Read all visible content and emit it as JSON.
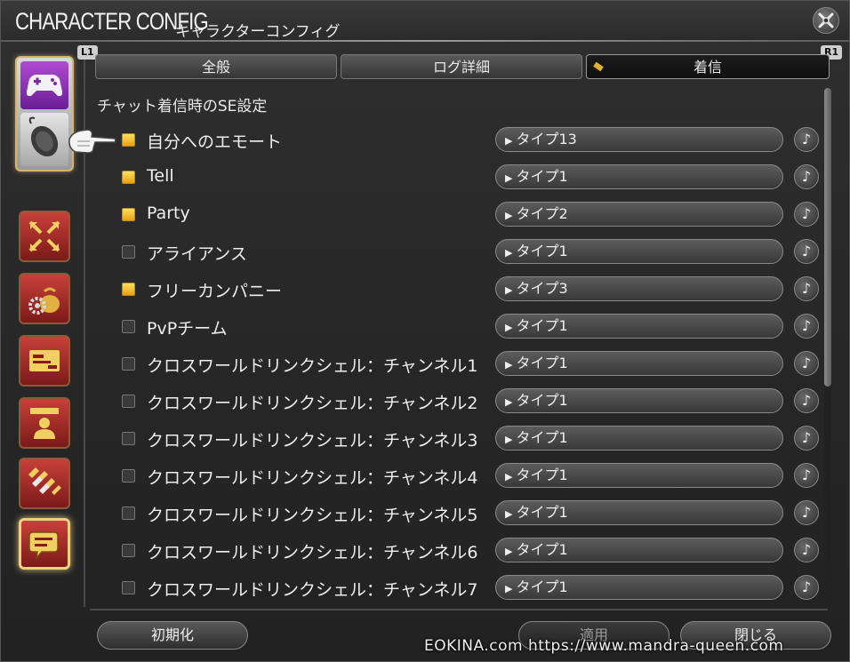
{
  "window": {
    "title": "CHARACTER CONFIG",
    "subtitle": "キャラクターコンフィグ"
  },
  "tab_hints": {
    "left": "L1",
    "right": "R1"
  },
  "tabs": [
    {
      "label": "全般",
      "active": false
    },
    {
      "label": "ログ詳細",
      "active": false
    },
    {
      "label": "着信",
      "active": true
    }
  ],
  "section_title": "チャット着信時のSE設定",
  "rows": [
    {
      "label": "自分へのエモート",
      "checked": true,
      "value": "タイプ13"
    },
    {
      "label": "Tell",
      "checked": true,
      "value": "タイプ1"
    },
    {
      "label": "Party",
      "checked": true,
      "value": "タイプ2"
    },
    {
      "label": "アライアンス",
      "checked": false,
      "value": "タイプ1"
    },
    {
      "label": "フリーカンパニー",
      "checked": true,
      "value": "タイプ3"
    },
    {
      "label": "PvPチーム",
      "checked": false,
      "value": "タイプ1"
    },
    {
      "label": "クロスワールドリンクシェル：チャンネル1",
      "checked": false,
      "value": "タイプ1"
    },
    {
      "label": "クロスワールドリンクシェル：チャンネル2",
      "checked": false,
      "value": "タイプ1"
    },
    {
      "label": "クロスワールドリンクシェル：チャンネル3",
      "checked": false,
      "value": "タイプ1"
    },
    {
      "label": "クロスワールドリンクシェル：チャンネル4",
      "checked": false,
      "value": "タイプ1"
    },
    {
      "label": "クロスワールドリンクシェル：チャンネル5",
      "checked": false,
      "value": "タイプ1"
    },
    {
      "label": "クロスワールドリンクシェル：チャンネル6",
      "checked": false,
      "value": "タイプ1"
    },
    {
      "label": "クロスワールドリンクシェル：チャンネル7",
      "checked": false,
      "value": "タイプ1"
    }
  ],
  "select_arrow": "▶",
  "sound_icon": "♪",
  "footer": {
    "reset": "初期化",
    "apply": "適用",
    "close": "閉じる"
  },
  "watermark": "EOKINA.com  https://www.mandra-queen.com",
  "colors": {
    "checkbox_on": "#f0c020",
    "accent_frame": "#f0d080",
    "sidebar_red": "#b0302c",
    "controller_purple": "#9a3cc0"
  }
}
